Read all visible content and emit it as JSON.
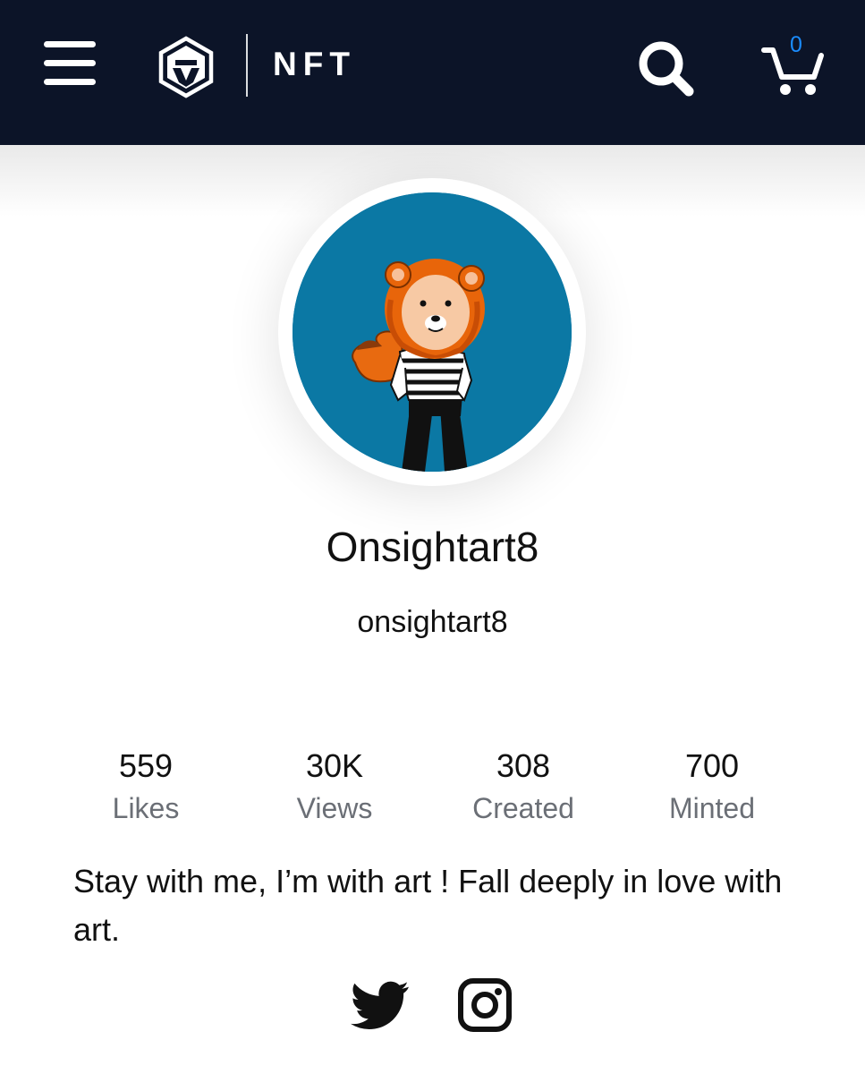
{
  "header": {
    "brand_text": "NFT",
    "cart_count": "0",
    "icons": {
      "menu": "hamburger-menu-icon",
      "logo": "crypto-com-lion-logo-icon",
      "search": "search-icon",
      "cart": "shopping-cart-icon"
    },
    "background_color": "#0c1428",
    "cart_badge_color": "#1a8cff"
  },
  "profile": {
    "display_name": "Onsightart8",
    "username": "onsightart8",
    "avatar_icon": "lion-character-avatar",
    "avatar_background": "#0b78a4",
    "stats": [
      {
        "value": "559",
        "label": "Likes"
      },
      {
        "value": "30K",
        "label": "Views"
      },
      {
        "value": "308",
        "label": "Created"
      },
      {
        "value": "700",
        "label": "Minted"
      }
    ],
    "bio": "Stay with me, I’m with art ! Fall deeply in love with art.",
    "social": [
      {
        "name": "twitter-icon"
      },
      {
        "name": "instagram-icon"
      }
    ]
  }
}
